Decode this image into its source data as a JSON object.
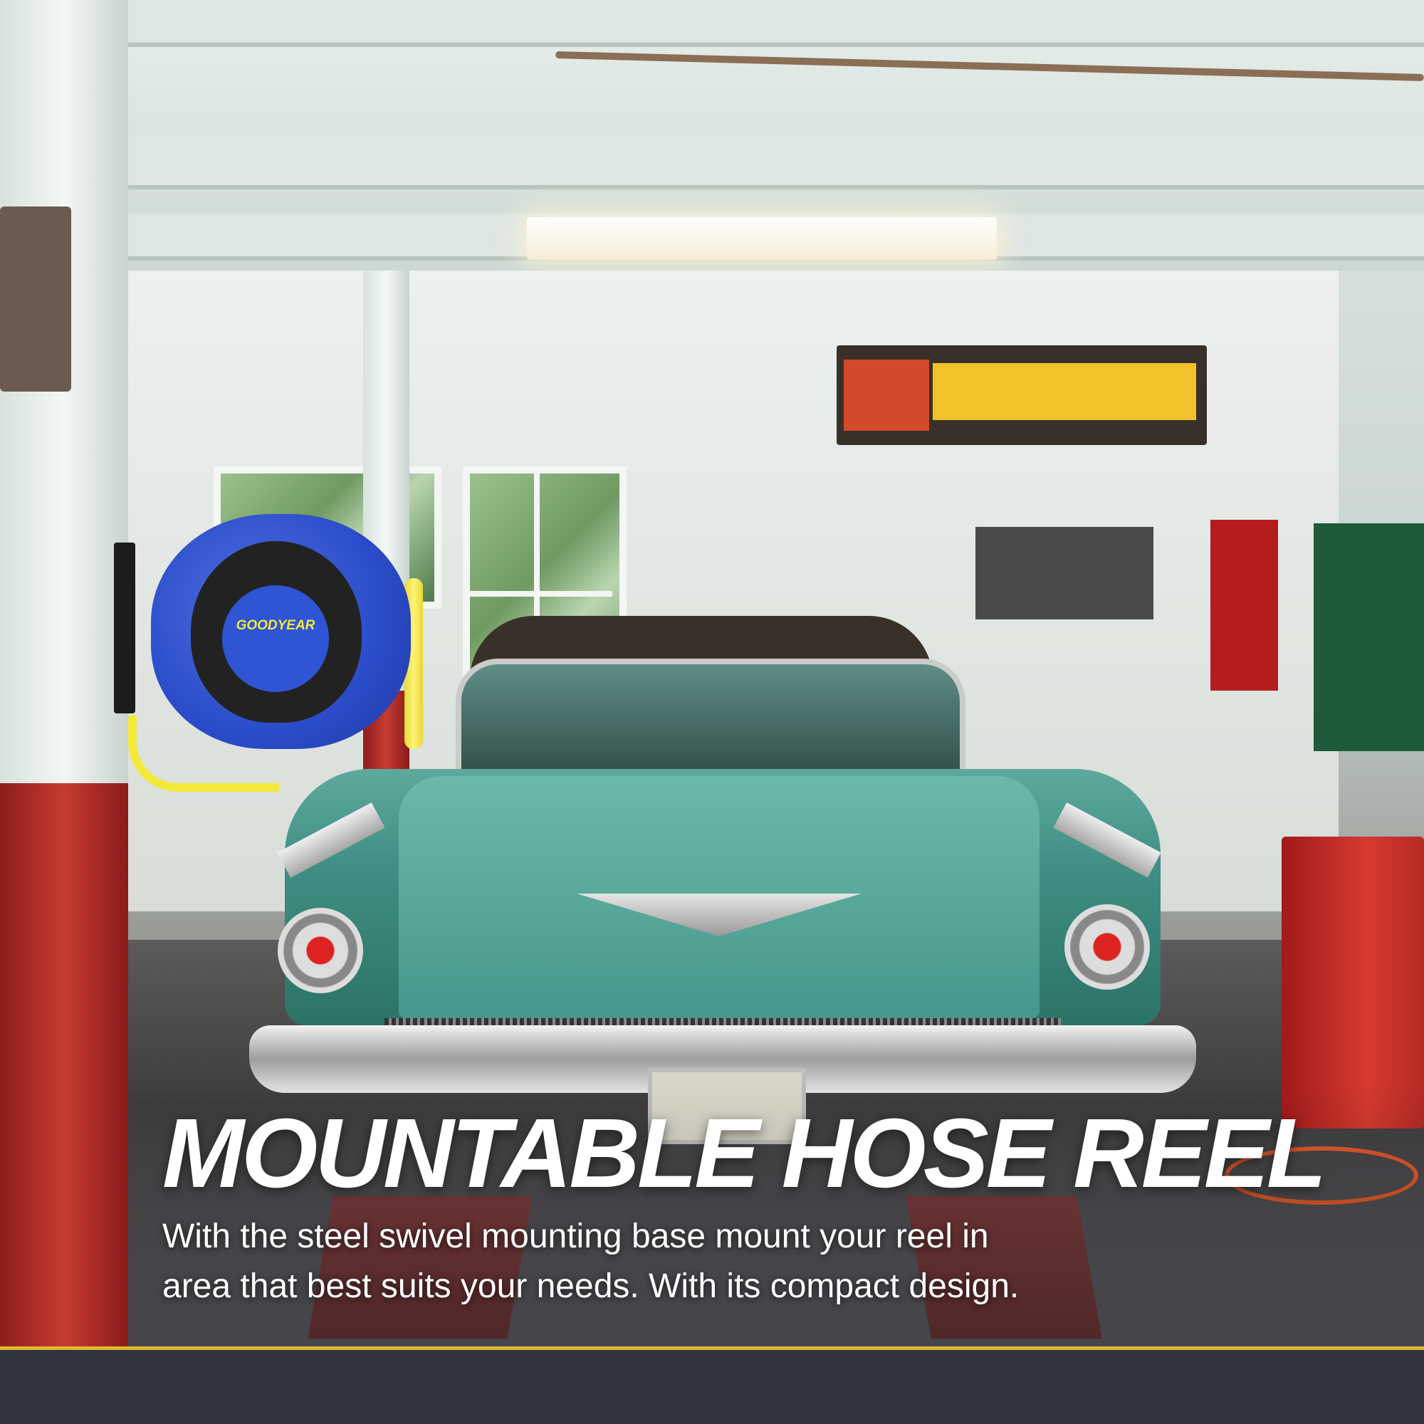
{
  "headline": "MOUNTABLE HOSE REEL",
  "subtext": {
    "line1": "With the steel swivel mounting  base mount your reel in",
    "line2": "area that best suits your needs. With its compact design."
  },
  "reel": {
    "brand_logo": "GOODYEAR"
  },
  "colors": {
    "reel_blue": "#2b4cc9",
    "hose_yellow": "#f2e93b",
    "footer": "#2f3440",
    "accent_line": "#e0b830"
  }
}
